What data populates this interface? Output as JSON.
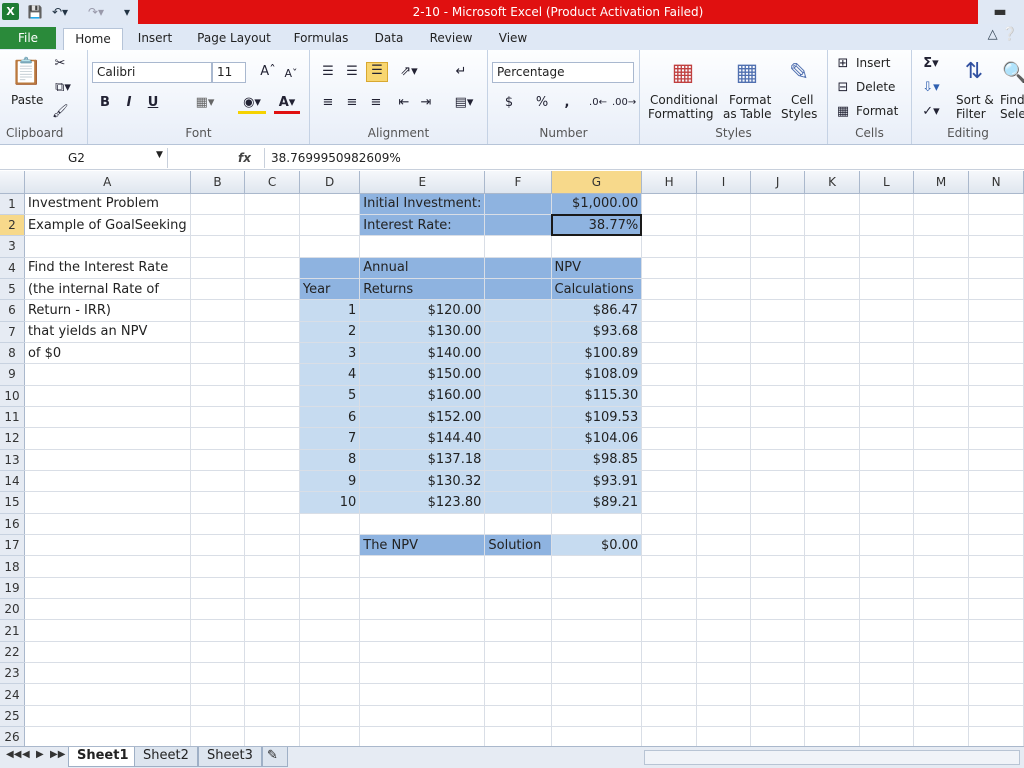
{
  "window": {
    "title": "2-10  -  Microsoft Excel (Product Activation Failed)",
    "app_icon": "X"
  },
  "ribbon_tabs": [
    "File",
    "Home",
    "Insert",
    "Page Layout",
    "Formulas",
    "Data",
    "Review",
    "View"
  ],
  "ribbon": {
    "clipboard": {
      "paste": "Paste",
      "label": "Clipboard"
    },
    "font": {
      "name": "Calibri",
      "size": "11",
      "bold": "B",
      "italic": "I",
      "underline": "U",
      "label": "Font"
    },
    "alignment": {
      "label": "Alignment"
    },
    "number": {
      "format": "Percentage",
      "currency": "$",
      "percent": "%",
      "comma": ",",
      "label": "Number"
    },
    "styles": {
      "conditional_1": "Conditional",
      "conditional_2": "Formatting",
      "format_table_1": "Format",
      "format_table_2": "as Table",
      "cell_styles_1": "Cell",
      "cell_styles_2": "Styles",
      "label": "Styles"
    },
    "cells": {
      "insert": "Insert",
      "delete": "Delete",
      "format": "Format",
      "label": "Cells"
    },
    "editing": {
      "sort_1": "Sort &",
      "sort_2": "Filter",
      "find_1": "Find",
      "find_2": "Selec",
      "label": "Editing"
    }
  },
  "formula_bar": {
    "name_box": "G2",
    "fx": "fx",
    "formula": "38.7699950982609%"
  },
  "columns": [
    "A",
    "B",
    "C",
    "D",
    "E",
    "F",
    "G",
    "H",
    "I",
    "J",
    "K",
    "L",
    "M",
    "N"
  ],
  "rows": [
    "1",
    "2",
    "3",
    "4",
    "5",
    "6",
    "7",
    "8",
    "9",
    "10",
    "11",
    "12",
    "13",
    "14",
    "15",
    "16",
    "17",
    "18",
    "19",
    "20",
    "21",
    "22",
    "23",
    "24",
    "25",
    "26"
  ],
  "cells": {
    "A1": "Investment Problem",
    "A2": "Example of GoalSeeking",
    "A4": "Find the Interest Rate",
    "A5": "(the internal Rate of",
    "A6": "Return - IRR)",
    "A7": "that yields an NPV",
    "A8": "of $0",
    "E1": "Initial Investment:",
    "G1": "$1,000.00",
    "E2": "Interest Rate:",
    "G2": "38.77%",
    "E4": "Annual",
    "G4": "NPV",
    "D5": "Year",
    "E5": "Returns",
    "G5": "Calculations",
    "E17": "The NPV",
    "F17": "Solution",
    "G17": "$0.00"
  },
  "table_rows": [
    {
      "year": "1",
      "ret": "$120.00",
      "npv": "$86.47"
    },
    {
      "year": "2",
      "ret": "$130.00",
      "npv": "$93.68"
    },
    {
      "year": "3",
      "ret": "$140.00",
      "npv": "$100.89"
    },
    {
      "year": "4",
      "ret": "$150.00",
      "npv": "$108.09"
    },
    {
      "year": "5",
      "ret": "$160.00",
      "npv": "$115.30"
    },
    {
      "year": "6",
      "ret": "$152.00",
      "npv": "$109.53"
    },
    {
      "year": "7",
      "ret": "$144.40",
      "npv": "$104.06"
    },
    {
      "year": "8",
      "ret": "$137.18",
      "npv": "$98.85"
    },
    {
      "year": "9",
      "ret": "$130.32",
      "npv": "$93.91"
    },
    {
      "year": "10",
      "ret": "$123.80",
      "npv": "$89.21"
    }
  ],
  "sheets": [
    "Sheet1",
    "Sheet2",
    "Sheet3"
  ],
  "colors": {
    "title_red": "#e01010",
    "file_green": "#2a8a3a",
    "cell_light_blue": "#c6dbf0",
    "cell_dark_blue": "#8eb3e0",
    "selection_header": "#f7d98b"
  }
}
